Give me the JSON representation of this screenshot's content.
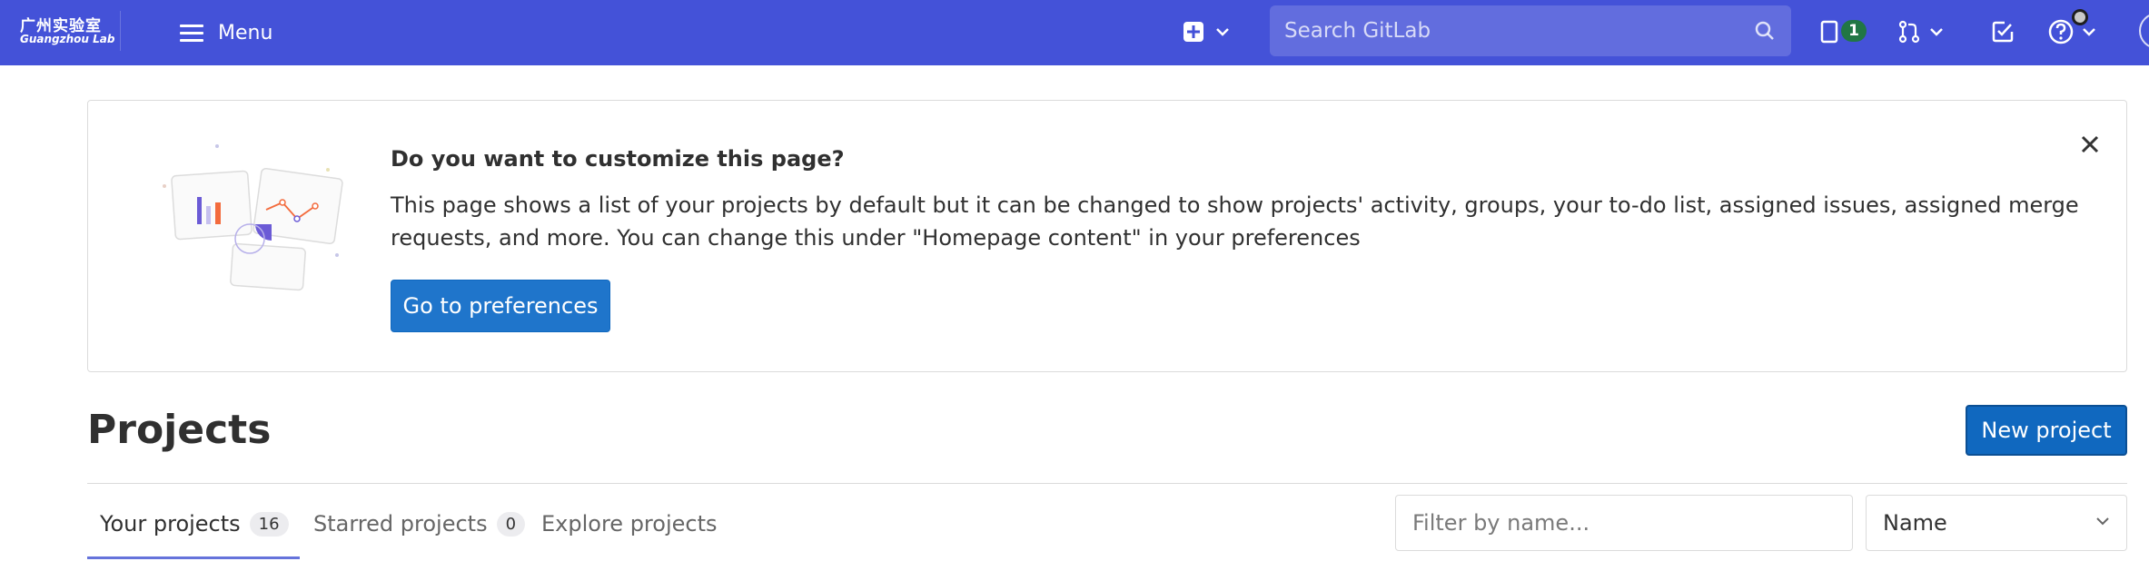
{
  "navbar": {
    "logo_cn": "广州实验室",
    "logo_en": "Guangzhou Lab",
    "menu_label": "Menu",
    "search_placeholder": "Search GitLab",
    "issues_count": "1",
    "bg_color": "#4452d8"
  },
  "callout": {
    "title": "Do you want to customize this page?",
    "body": "This page shows a list of your projects by default but it can be changed to show projects' activity, groups, your to-do list, assigned issues, assigned merge requests, and more. You can change this under \"Homepage content\" in your preferences",
    "button_label": "Go to preferences"
  },
  "page": {
    "title": "Projects",
    "new_project_label": "New project"
  },
  "tabs": [
    {
      "label": "Your projects",
      "count": "16",
      "active": true
    },
    {
      "label": "Starred projects",
      "count": "0",
      "active": false
    },
    {
      "label": "Explore projects",
      "count": null,
      "active": false
    }
  ],
  "filter": {
    "placeholder": "Filter by name...",
    "sort_value": "Name"
  },
  "icons": [
    "hamburger-icon",
    "plus-square-icon",
    "chevron-down-icon",
    "search-icon",
    "issues-icon",
    "merge-request-icon",
    "todo-check-icon",
    "help-icon",
    "close-icon"
  ]
}
